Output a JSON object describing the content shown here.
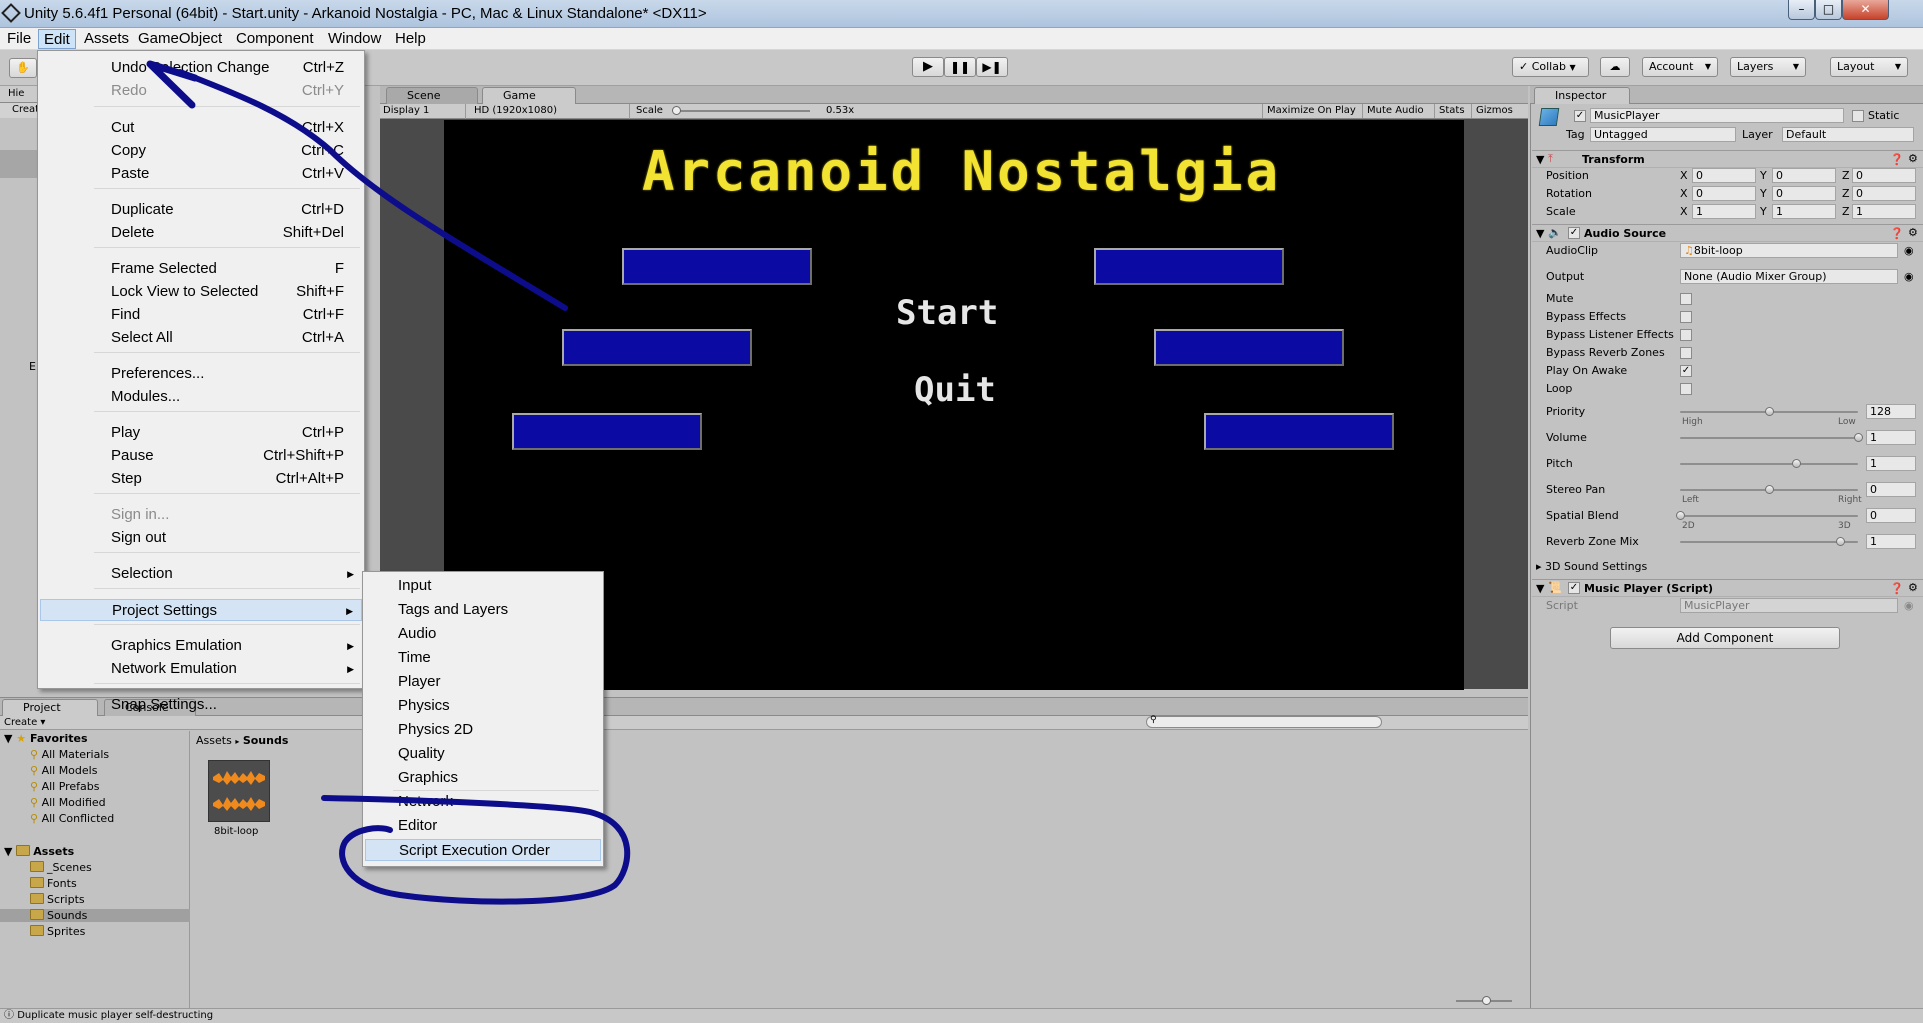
{
  "window": {
    "title": "Unity 5.6.4f1 Personal (64bit) - Start.unity - Arkanoid Nostalgia - PC, Mac & Linux Standalone* <DX11>"
  },
  "menubar": [
    "File",
    "Edit",
    "Assets",
    "GameObject",
    "Component",
    "Window",
    "Help"
  ],
  "toolbar": {
    "collab": "Collab",
    "account": "Account",
    "layers": "Layers",
    "layout": "Layout"
  },
  "edit_menu": [
    {
      "label": "Undo Selection Change",
      "shortcut": "Ctrl+Z"
    },
    {
      "label": "Redo",
      "shortcut": "Ctrl+Y",
      "disabled": true
    },
    {
      "label": "Cut",
      "shortcut": "Ctrl+X"
    },
    {
      "label": "Copy",
      "shortcut": "Ctrl+C"
    },
    {
      "label": "Paste",
      "shortcut": "Ctrl+V"
    },
    {
      "label": "Duplicate",
      "shortcut": "Ctrl+D"
    },
    {
      "label": "Delete",
      "shortcut": "Shift+Del"
    },
    {
      "label": "Frame Selected",
      "shortcut": "F"
    },
    {
      "label": "Lock View to Selected",
      "shortcut": "Shift+F"
    },
    {
      "label": "Find",
      "shortcut": "Ctrl+F"
    },
    {
      "label": "Select All",
      "shortcut": "Ctrl+A"
    },
    {
      "label": "Preferences...",
      "shortcut": ""
    },
    {
      "label": "Modules...",
      "shortcut": ""
    },
    {
      "label": "Play",
      "shortcut": "Ctrl+P"
    },
    {
      "label": "Pause",
      "shortcut": "Ctrl+Shift+P"
    },
    {
      "label": "Step",
      "shortcut": "Ctrl+Alt+P"
    },
    {
      "label": "Sign in...",
      "shortcut": "",
      "disabled": true
    },
    {
      "label": "Sign out",
      "shortcut": ""
    },
    {
      "label": "Selection",
      "shortcut": ""
    },
    {
      "label": "Project Settings",
      "shortcut": ""
    },
    {
      "label": "Graphics Emulation",
      "shortcut": ""
    },
    {
      "label": "Network Emulation",
      "shortcut": ""
    },
    {
      "label": "Snap Settings...",
      "shortcut": ""
    }
  ],
  "project_settings_menu": [
    "Input",
    "Tags and Layers",
    "Audio",
    "Time",
    "Player",
    "Physics",
    "Physics 2D",
    "Quality",
    "Graphics",
    "Network",
    "Editor",
    "Script Execution Order"
  ],
  "left_fragments": {
    "hier": "Hie",
    "create": "Creat",
    "e": "E"
  },
  "scene_tabs": {
    "scene": "Scene",
    "game": "Game"
  },
  "game_bar": {
    "display": "Display 1",
    "resolution": "HD (1920x1080)",
    "scale_label": "Scale",
    "scale_value": "0.53x",
    "maximize": "Maximize On Play",
    "mute": "Mute Audio",
    "stats": "Stats",
    "gizmos": "Gizmos"
  },
  "game_view": {
    "title": "Arcanoid Nostalgia",
    "start": "Start",
    "quit": "Quit"
  },
  "project": {
    "tab_project": "Project",
    "tab_console": "Console",
    "create": "Create",
    "favorites_label": "Favorites",
    "favorites": [
      "All Materials",
      "All Models",
      "All Prefabs",
      "All Modified",
      "All Conflicted"
    ],
    "assets_label": "Assets",
    "assets": [
      "_Scenes",
      "Fonts",
      "Scripts",
      "Sounds",
      "Sprites"
    ],
    "breadcrumb_root": "Assets",
    "breadcrumb_leaf": "Sounds",
    "asset_item": "8bit-loop"
  },
  "status_bar": "Duplicate music player self-destructing",
  "inspector": {
    "tab": "Inspector",
    "object_name": "MusicPlayer",
    "static": "Static",
    "tag_label": "Tag",
    "tag_value": "Untagged",
    "layer_label": "Layer",
    "layer_value": "Default",
    "transform": {
      "title": "Transform",
      "rows": [
        {
          "label": "Position",
          "x": "0",
          "y": "0",
          "z": "0"
        },
        {
          "label": "Rotation",
          "x": "0",
          "y": "0",
          "z": "0"
        },
        {
          "label": "Scale",
          "x": "1",
          "y": "1",
          "z": "1"
        }
      ]
    },
    "audio_source": {
      "title": "Audio Source",
      "audio_clip_label": "AudioClip",
      "audio_clip": "8bit-loop",
      "output_label": "Output",
      "output": "None (Audio Mixer Group)",
      "checks": [
        {
          "label": "Mute",
          "checked": false
        },
        {
          "label": "Bypass Effects",
          "checked": false
        },
        {
          "label": "Bypass Listener Effects",
          "checked": false
        },
        {
          "label": "Bypass Reverb Zones",
          "checked": false
        },
        {
          "label": "Play On Awake",
          "checked": true
        },
        {
          "label": "Loop",
          "checked": false
        }
      ],
      "sliders": [
        {
          "label": "Priority",
          "value": "128",
          "min_label": "High",
          "max_label": "Low",
          "fraction": 0.5
        },
        {
          "label": "Volume",
          "value": "1",
          "fraction": 1.0
        },
        {
          "label": "Pitch",
          "value": "1",
          "fraction": 0.65
        },
        {
          "label": "Stereo Pan",
          "value": "0",
          "min_label": "Left",
          "max_label": "Right",
          "fraction": 0.5
        },
        {
          "label": "Spatial Blend",
          "value": "0",
          "min_label": "2D",
          "max_label": "3D",
          "fraction": 0.0
        },
        {
          "label": "Reverb Zone Mix",
          "value": "1",
          "fraction": 0.9
        }
      ],
      "sound3d": "3D Sound Settings"
    },
    "script_comp": {
      "title": "Music Player (Script)",
      "script_label": "Script",
      "script_value": "MusicPlayer"
    },
    "add_component": "Add Component"
  },
  "colors": {
    "annotation": "#0d0d8c",
    "game_bg": "#000000",
    "title_yellow": "#f2e232",
    "brick_blue": "#0b0ba3"
  }
}
